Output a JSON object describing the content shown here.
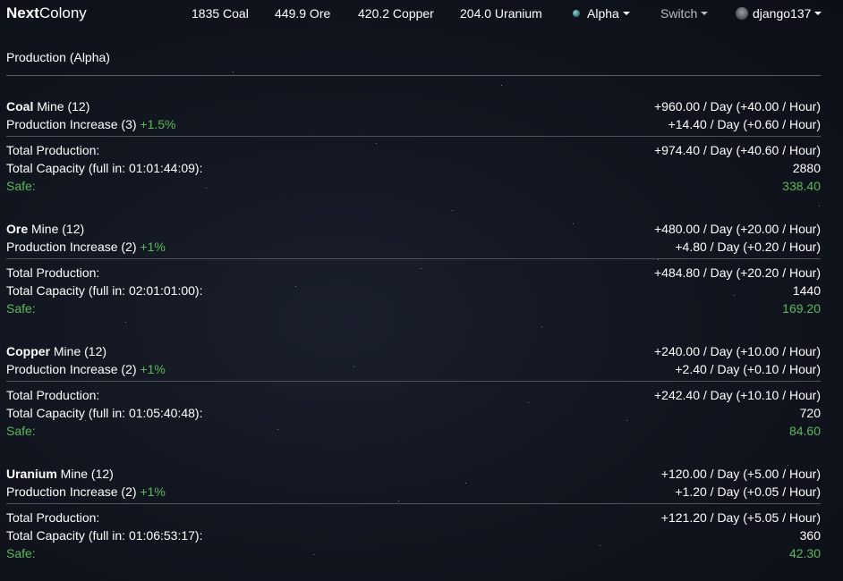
{
  "navbar": {
    "brand_bold": "Next",
    "brand_rest": "Colony",
    "resources": {
      "coal": "1835 Coal",
      "ore": "449.9 Ore",
      "copper": "420.2 Copper",
      "uranium": "204.0 Uranium"
    },
    "planet": "Alpha",
    "switch_label": "Switch",
    "username": "django137"
  },
  "panel": {
    "title": "Production (Alpha)"
  },
  "labels": {
    "mine_suffix": " Mine (12)",
    "total_production": "Total Production:",
    "safe": "Safe:"
  },
  "resources": [
    {
      "name": "Coal",
      "mine_rate": "+960.00 / Day (+40.00 / Hour)",
      "increase_label": "Production Increase (3)",
      "increase_pct": "+1.5%",
      "increase_rate": "+14.40 / Day (+0.60 / Hour)",
      "total_rate": "+974.40 / Day (+40.60 / Hour)",
      "capacity_label": "Total Capacity (full in: 01:01:44:09):",
      "capacity": "2880",
      "safe": "338.40"
    },
    {
      "name": "Ore",
      "mine_rate": "+480.00 / Day (+20.00 / Hour)",
      "increase_label": "Production Increase (2)",
      "increase_pct": "+1%",
      "increase_rate": "+4.80 / Day (+0.20 / Hour)",
      "total_rate": "+484.80 / Day (+20.20 / Hour)",
      "capacity_label": "Total Capacity (full in: 02:01:01:00):",
      "capacity": "1440",
      "safe": "169.20"
    },
    {
      "name": "Copper",
      "mine_rate": "+240.00 / Day (+10.00 / Hour)",
      "increase_label": "Production Increase (2)",
      "increase_pct": "+1%",
      "increase_rate": "+2.40 / Day (+0.10 / Hour)",
      "total_rate": "+242.40 / Day (+10.10 / Hour)",
      "capacity_label": "Total Capacity (full in: 01:05:40:48):",
      "capacity": "720",
      "safe": "84.60"
    },
    {
      "name": "Uranium",
      "mine_rate": "+120.00 / Day (+5.00 / Hour)",
      "increase_label": "Production Increase (2)",
      "increase_pct": "+1%",
      "increase_rate": "+1.20 / Day (+0.05 / Hour)",
      "total_rate": "+121.20 / Day (+5.05 / Hour)",
      "capacity_label": "Total Capacity (full in: 01:06:53:17):",
      "capacity": "360",
      "safe": "42.30"
    }
  ],
  "colors": {
    "background": "#121620",
    "text": "#ffffff",
    "accent_green": "#5cb85c",
    "divider": "#4e525a"
  },
  "icons": {
    "planet": "planet-icon",
    "avatar": "user-avatar-icon",
    "dropdown": "caret-down-icon"
  }
}
